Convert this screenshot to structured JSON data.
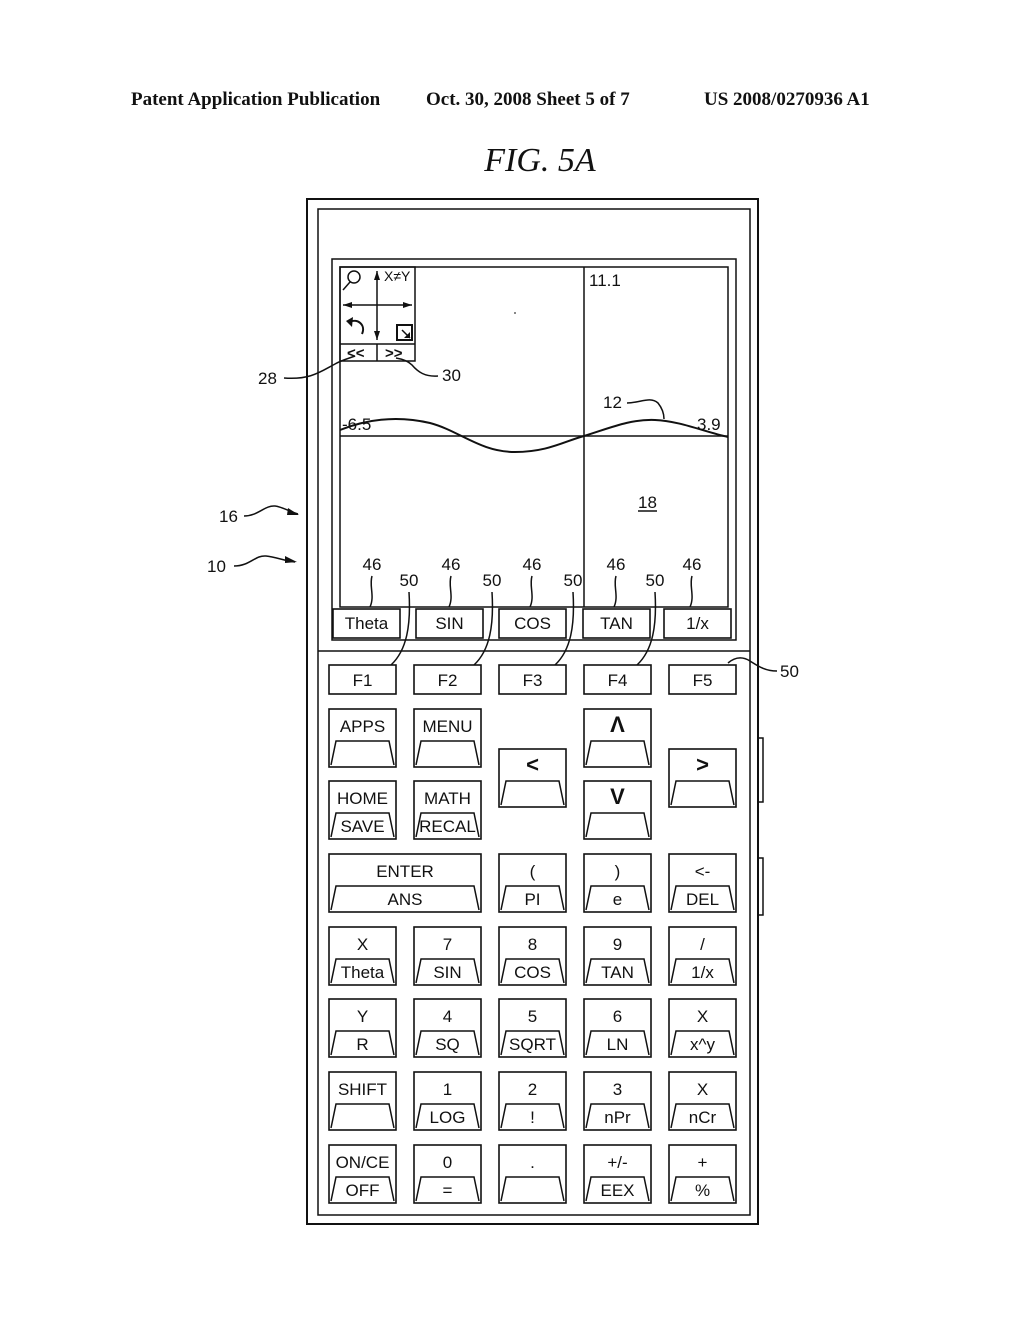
{
  "header": {
    "left": "Patent Application Publication",
    "middle": "Oct. 30, 2008  Sheet 5 of 7",
    "right": "US 2008/0270936 A1"
  },
  "figure_title": "FIG. 5A",
  "reference_numerals": {
    "device": "10",
    "graph": "12",
    "housing": "16",
    "screen_area": "18",
    "back_button": "28",
    "forward_button": "30",
    "soft_label": "46",
    "function_key": "50"
  },
  "screen": {
    "toolbar": {
      "zoom_icon": "magnifier-icon",
      "swap_label": "X≠Y",
      "undo_icon": "undo-icon",
      "resize_icon": "resize-corner-icon",
      "back_label": "<<",
      "forward_label": ">>"
    },
    "graph": {
      "y_max_label": "11.1",
      "x_min_label": "-6.5",
      "x_max_label": "3.9"
    },
    "soft_keys": [
      "Theta",
      "SIN",
      "COS",
      "TAN",
      "1/x"
    ]
  },
  "function_keys": [
    "F1",
    "F2",
    "F3",
    "F4",
    "F5"
  ],
  "keys": {
    "apps": {
      "top": "APPS",
      "bottom": ""
    },
    "menu": {
      "top": "MENU",
      "bottom": ""
    },
    "home": {
      "top": "HOME",
      "bottom": "SAVE"
    },
    "math": {
      "top": "MATH",
      "bottom": "RECAL"
    },
    "left": {
      "top": "<",
      "bottom": ""
    },
    "up": {
      "top": "Λ",
      "bottom": ""
    },
    "down": {
      "top": "V",
      "bottom": ""
    },
    "right": {
      "top": ">",
      "bottom": ""
    },
    "enter": {
      "top": "ENTER",
      "bottom": "ANS"
    },
    "rows": [
      [
        {
          "top": "(",
          "bottom": "PI"
        },
        {
          "top": ")",
          "bottom": "e"
        },
        {
          "top": "<-",
          "bottom": "DEL"
        }
      ],
      [
        {
          "top": "X",
          "bottom": "Theta"
        },
        {
          "top": "7",
          "bottom": "SIN"
        },
        {
          "top": "8",
          "bottom": "COS"
        },
        {
          "top": "9",
          "bottom": "TAN"
        },
        {
          "top": "/",
          "bottom": "1/x"
        }
      ],
      [
        {
          "top": "Y",
          "bottom": "R"
        },
        {
          "top": "4",
          "bottom": "SQ"
        },
        {
          "top": "5",
          "bottom": "SQRT"
        },
        {
          "top": "6",
          "bottom": "LN"
        },
        {
          "top": "X",
          "bottom": "x^y"
        }
      ],
      [
        {
          "top": "SHIFT",
          "bottom": ""
        },
        {
          "top": "1",
          "bottom": "LOG"
        },
        {
          "top": "2",
          "bottom": "!"
        },
        {
          "top": "3",
          "bottom": "nPr"
        },
        {
          "top": "X",
          "bottom": "nCr"
        }
      ],
      [
        {
          "top": "ON/CE",
          "bottom": "OFF"
        },
        {
          "top": "0",
          "bottom": "="
        },
        {
          "top": ".",
          "bottom": ""
        },
        {
          "top": "+/-",
          "bottom": "EEX"
        },
        {
          "top": "+",
          "bottom": "%"
        }
      ]
    ]
  }
}
